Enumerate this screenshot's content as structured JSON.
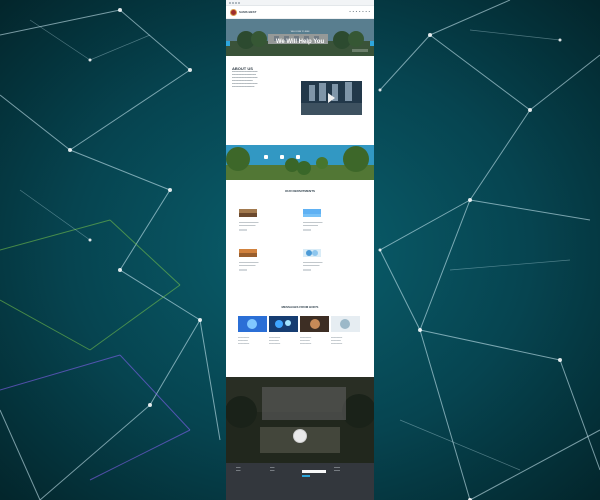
{
  "brand": {
    "name": "SAMS BEST"
  },
  "hero": {
    "small": "WELCOME TO SBM",
    "title": "We Will Help You"
  },
  "about": {
    "title": "ABOUT US"
  },
  "departments": {
    "title": "OUR DEPARTMENTS"
  },
  "messages": {
    "title": "MESSAGES FROM HOD'S"
  }
}
